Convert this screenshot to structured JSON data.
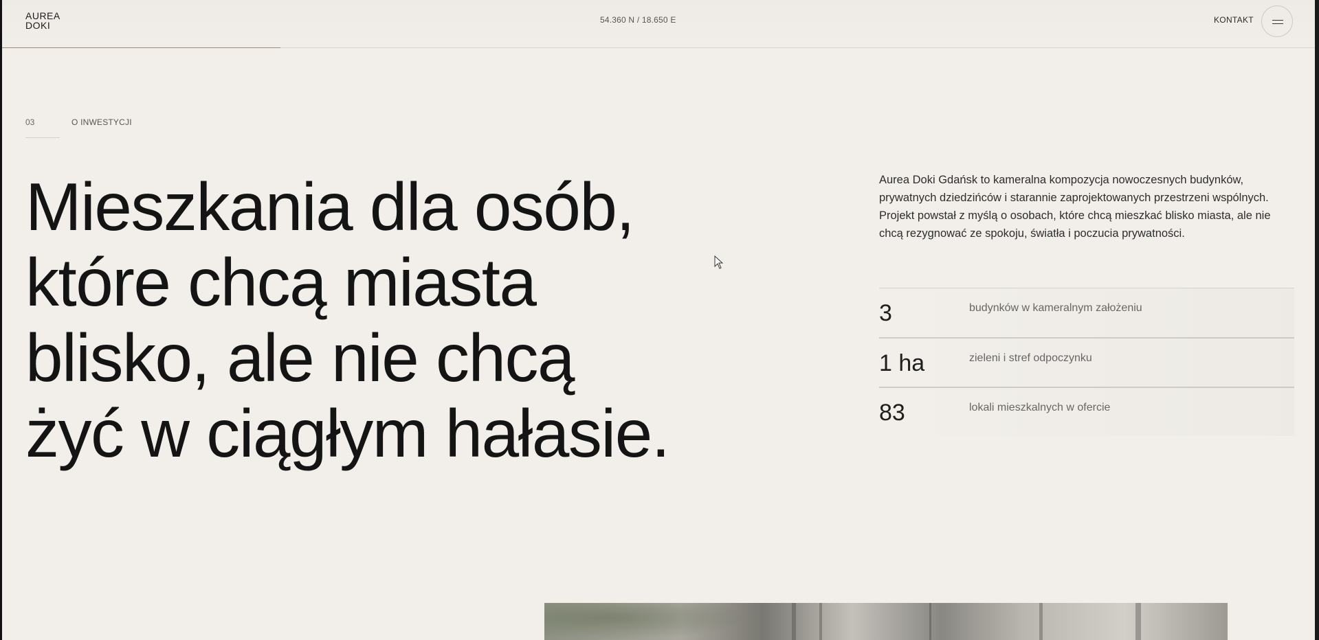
{
  "header": {
    "logo_line1": "AUREA",
    "logo_line2": "DOKI",
    "coordinates": "54.360 N / 18.650 E",
    "contact_label": "KONTAKT",
    "menu_icon": "hamburger-icon"
  },
  "section": {
    "number": "03",
    "title": "O INWESTYCJI"
  },
  "headline": {
    "line1": "Mieszkania dla osób,",
    "line2": "które chcą miasta",
    "line3": "blisko, ale nie chcą",
    "line4": "żyć w ciągłym hałasie."
  },
  "description": "Aurea Doki Gdańsk to kameralna kompozycja nowoczesnych budynków, prywatnych dziedzińców i starannie zaprojektowanych przestrzeni wspólnych. Projekt powstał z myślą o osobach, które chcą mieszkać blisko miasta, ale nie chcą rezygnować ze spokoju, światła i poczucia prywatności.",
  "stats": [
    {
      "value": "3",
      "label": "budynków w kameralnym założeniu"
    },
    {
      "value": "1 ha",
      "label": "zieleni i stref odpoczynku"
    },
    {
      "value": "83",
      "label": "lokali mieszkalnych w ofercie"
    }
  ],
  "colors": {
    "background": "#f2efea",
    "text": "#141414",
    "accent_line": "#9a8a76"
  }
}
